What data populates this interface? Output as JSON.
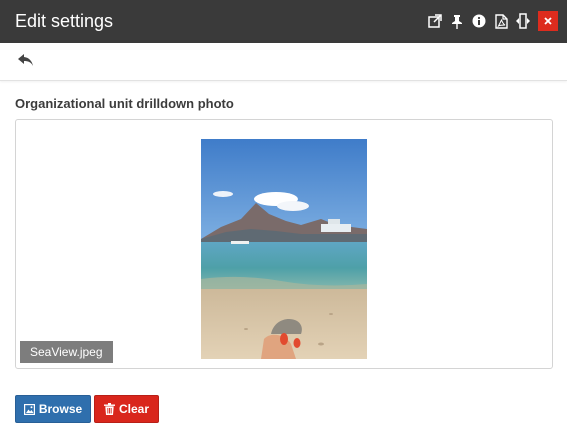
{
  "window": {
    "title": "Edit settings",
    "title_bg": "#3a3a3a",
    "icons": [
      "popout-icon",
      "pin-icon",
      "info-icon",
      "pdf-icon",
      "resize-icon",
      "close-icon"
    ],
    "close_label": "×",
    "close_color": "#dd2c1e"
  },
  "toolbar": {
    "back_icon": "back-arrow-icon"
  },
  "field": {
    "label": "Organizational unit drilldown photo",
    "file_name": "SeaView.jpeg"
  },
  "actions": {
    "browse_label": "Browse",
    "browse_color": "#2f6fad",
    "clear_label": "Clear",
    "clear_color": "#d9261c"
  }
}
